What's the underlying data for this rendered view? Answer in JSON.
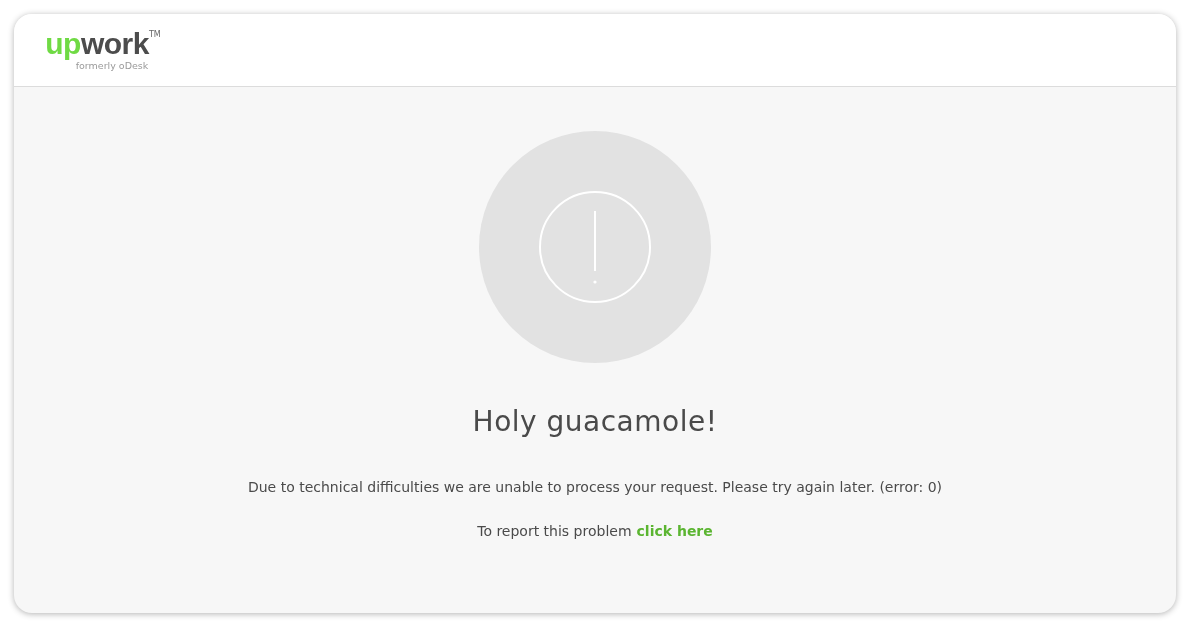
{
  "header": {
    "logo": {
      "parts": [
        {
          "text": "up",
          "color": "#6fda44"
        },
        {
          "text": "work",
          "color": "#4c4c4c"
        }
      ],
      "trademark": "TM",
      "tagline": "formerly oDesk"
    }
  },
  "error": {
    "title": "Holy guacamole!",
    "message": "Due to technical difficulties we are unable to process your request. Please try again later. (error: 0)",
    "report_text": "To report this problem",
    "report_link": "click here"
  }
}
